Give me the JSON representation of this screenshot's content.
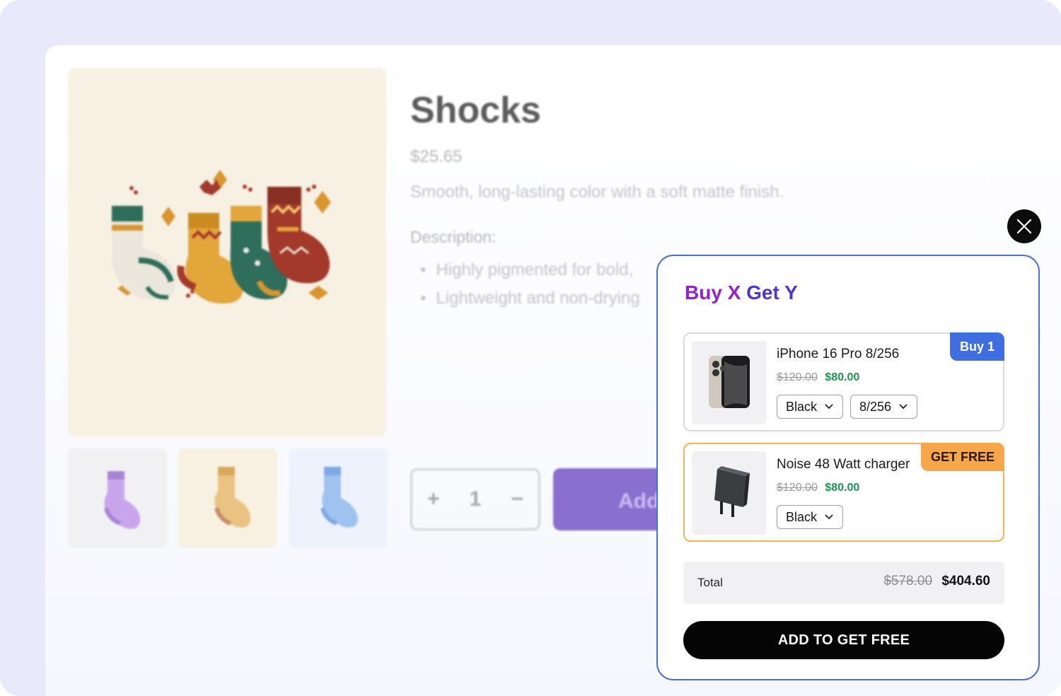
{
  "product": {
    "title": "Shocks",
    "price": "$25.65",
    "subtitle": "Smooth, long-lasting color with a soft matte finish.",
    "description_heading": "Description:",
    "description_items": [
      "Highly pigmented for bold,",
      "Lightweight and non-drying"
    ],
    "quantity": "1",
    "qty_plus": "+",
    "qty_minus": "−",
    "add_label": "Add",
    "thumbnail_colors": [
      "#c9a6ec",
      "#e9c37f",
      "#9fc2f0"
    ]
  },
  "modal": {
    "close_icon": "close-icon",
    "title_part1": "Buy X ",
    "title_part2": "Get Y",
    "items": [
      {
        "badge": "Buy 1",
        "name": "iPhone 16 Pro 8/256",
        "old_price": "$120.00",
        "new_price": "$80.00",
        "options": [
          "Black",
          "8/256"
        ],
        "image_icon": "phone-icon"
      },
      {
        "badge": "GET FREE",
        "name": "Noise 48 Watt charger",
        "old_price": "$120.00",
        "new_price": "$80.00",
        "options": [
          "Black"
        ],
        "image_icon": "charger-icon"
      }
    ],
    "total_label": "Total",
    "total_old": "$578.00",
    "total_new": "$404.60",
    "cta_label": "ADD TO GET FREE"
  },
  "colors": {
    "modal_border": "#4d6fd0",
    "title_purple": "#9323c4",
    "title_blue": "#4d36cf",
    "buy_badge": "#3f6ee3",
    "free_badge": "#f7a64a",
    "price_green": "#1f9450",
    "cta": "#050505"
  }
}
